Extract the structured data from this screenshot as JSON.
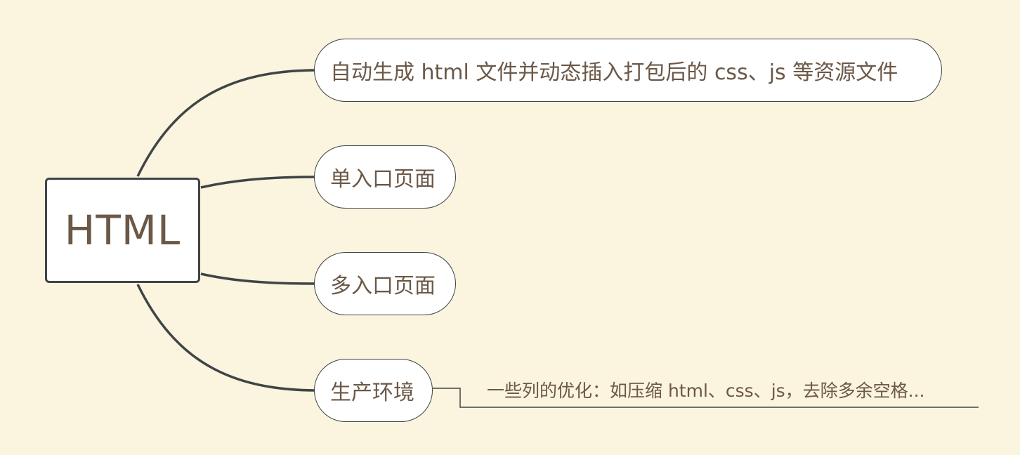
{
  "mindmap": {
    "root": {
      "label": "HTML"
    },
    "topics": [
      {
        "label": "自动生成 html 文件并动态插入打包后的 css、js 等资源文件"
      },
      {
        "label": "单入口页面"
      },
      {
        "label": "多入口页面"
      },
      {
        "label": "生产环境",
        "note": "一些列的优化：如压缩 html、css、js，去除多余空格..."
      }
    ]
  },
  "colors": {
    "background": "#fbf4de",
    "text": "#6b5847",
    "line": "#3f4447",
    "node_fill": "#ffffff"
  }
}
